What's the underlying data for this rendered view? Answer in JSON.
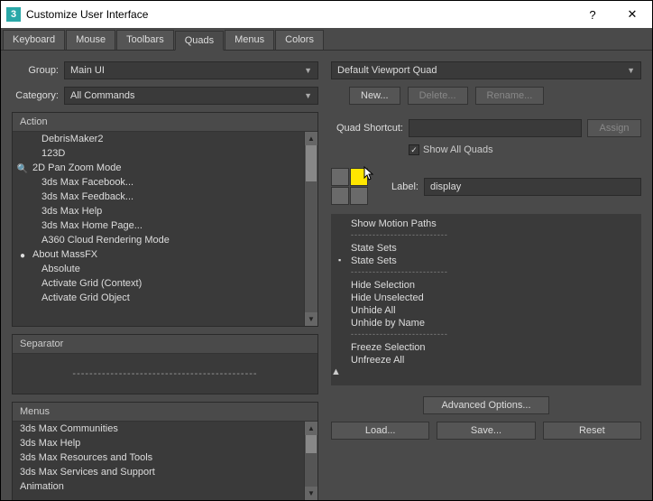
{
  "window": {
    "title": "Customize User Interface"
  },
  "tabs": [
    "Keyboard",
    "Mouse",
    "Toolbars",
    "Quads",
    "Menus",
    "Colors"
  ],
  "active_tab": "Quads",
  "left": {
    "group_label": "Group:",
    "group_value": "Main UI",
    "category_label": "Category:",
    "category_value": "All Commands",
    "action_header": "Action",
    "actions": [
      {
        "label": "DebrisMaker2",
        "indent": true,
        "icon": ""
      },
      {
        "label": "123D",
        "indent": true,
        "icon": ""
      },
      {
        "label": "2D Pan Zoom Mode",
        "indent": false,
        "icon": "🔍"
      },
      {
        "label": "3ds Max Facebook...",
        "indent": true,
        "icon": ""
      },
      {
        "label": "3ds Max Feedback...",
        "indent": true,
        "icon": ""
      },
      {
        "label": "3ds Max Help",
        "indent": true,
        "icon": ""
      },
      {
        "label": "3ds Max Home Page...",
        "indent": true,
        "icon": ""
      },
      {
        "label": "A360 Cloud Rendering Mode",
        "indent": true,
        "icon": ""
      },
      {
        "label": "About MassFX",
        "indent": false,
        "icon": "●"
      },
      {
        "label": "Absolute",
        "indent": true,
        "icon": ""
      },
      {
        "label": "Activate Grid (Context)",
        "indent": true,
        "icon": ""
      },
      {
        "label": "Activate Grid Object",
        "indent": true,
        "icon": ""
      }
    ],
    "separator_header": "Separator",
    "separator_line": "--------------------------------------------",
    "menus_header": "Menus",
    "menus": [
      "3ds Max Communities",
      "3ds Max Help",
      "3ds Max Resources and Tools",
      "3ds Max Services and Support",
      "Animation"
    ]
  },
  "right": {
    "quad_select": "Default Viewport Quad",
    "new_btn": "New...",
    "delete_btn": "Delete...",
    "rename_btn": "Rename...",
    "shortcut_label": "Quad Shortcut:",
    "shortcut_value": "",
    "assign_btn": "Assign",
    "show_all_label": "Show All Quads",
    "label_label": "Label:",
    "label_value": "display",
    "tree": [
      {
        "t": "node",
        "label": "Show Motion Paths"
      },
      {
        "t": "dots"
      },
      {
        "t": "node",
        "label": "State Sets"
      },
      {
        "t": "node",
        "label": "State Sets",
        "exp": "col"
      },
      {
        "t": "dots"
      },
      {
        "t": "node",
        "label": "Hide Selection"
      },
      {
        "t": "node",
        "label": "Hide Unselected"
      },
      {
        "t": "node",
        "label": "Unhide All"
      },
      {
        "t": "node",
        "label": "Unhide by Name"
      },
      {
        "t": "dots"
      },
      {
        "t": "node",
        "label": "Freeze Selection"
      },
      {
        "t": "node",
        "label": "Unfreeze All"
      }
    ],
    "advanced_btn": "Advanced Options...",
    "load_btn": "Load...",
    "save_btn": "Save...",
    "reset_btn": "Reset"
  }
}
